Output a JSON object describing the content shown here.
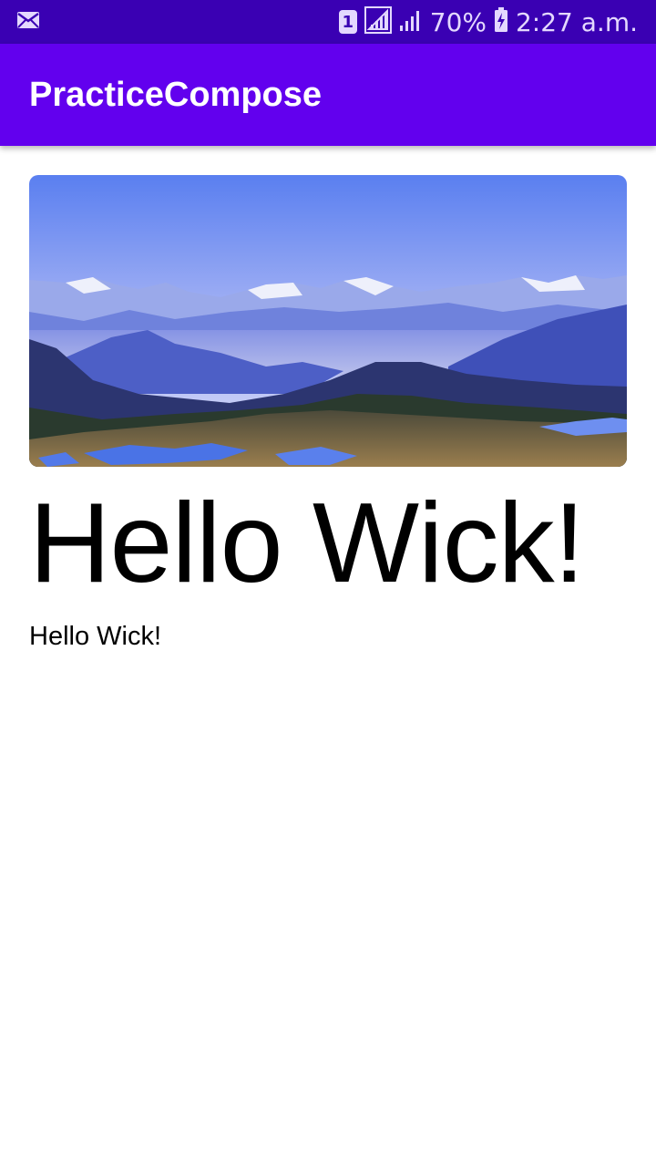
{
  "status_bar": {
    "left_icons": [
      "mail-icon"
    ],
    "sim_label": "1",
    "battery_percent": "70%",
    "time": "2:27 a.m.",
    "icons": [
      "sim-icon",
      "signal-icon",
      "signal-icon-2",
      "battery-charging-icon"
    ]
  },
  "app_bar": {
    "title": "PracticeCompose"
  },
  "content": {
    "image_icon": "mountain-landscape-image",
    "headline": "Hello Wick!",
    "body": "Hello Wick!"
  },
  "colors": {
    "status_bar": "#3a00b3",
    "app_bar": "#6200ee",
    "background": "#ffffff"
  }
}
